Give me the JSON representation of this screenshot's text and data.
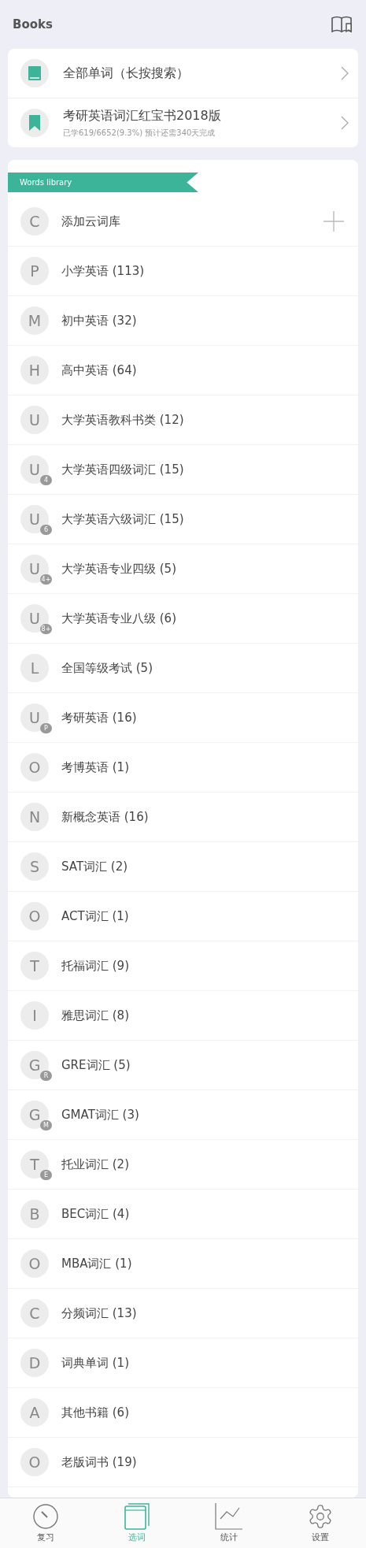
{
  "header": {
    "title": "Books"
  },
  "books": [
    {
      "kind": "all",
      "title": "全部单词（长按搜索）"
    },
    {
      "kind": "current",
      "title": "考研英语词汇红宝书2018版",
      "subtitle": "已学619/6652(9.3%) 预计还需340天完成"
    }
  ],
  "library": {
    "banner": "Words library",
    "rows": [
      {
        "kind": "add",
        "letter": "C",
        "label": "添加云词库"
      },
      {
        "kind": "book",
        "letter": "P",
        "label": "小学英语 (113)"
      },
      {
        "kind": "book",
        "letter": "M",
        "label": "初中英语 (32)"
      },
      {
        "kind": "book",
        "letter": "H",
        "label": "高中英语 (64)"
      },
      {
        "kind": "book",
        "letter": "U",
        "label": "大学英语教科书类 (12)"
      },
      {
        "kind": "book",
        "letter": "U",
        "badge": "4",
        "label": "大学英语四级词汇 (15)"
      },
      {
        "kind": "book",
        "letter": "U",
        "badge": "6",
        "label": "大学英语六级词汇 (15)"
      },
      {
        "kind": "book",
        "letter": "U",
        "badge": "4+",
        "label": "大学英语专业四级 (5)"
      },
      {
        "kind": "book",
        "letter": "U",
        "badge": "8+",
        "label": "大学英语专业八级 (6)"
      },
      {
        "kind": "book",
        "letter": "L",
        "label": "全国等级考试 (5)"
      },
      {
        "kind": "book",
        "letter": "U",
        "badge": "P",
        "label": "考研英语 (16)"
      },
      {
        "kind": "book",
        "letter": "O",
        "label": "考博英语 (1)"
      },
      {
        "kind": "book",
        "letter": "N",
        "label": "新概念英语 (16)"
      },
      {
        "kind": "book",
        "letter": "S",
        "label": "SAT词汇 (2)"
      },
      {
        "kind": "book",
        "letter": "O",
        "label": "ACT词汇 (1)"
      },
      {
        "kind": "book",
        "letter": "T",
        "label": "托福词汇 (9)"
      },
      {
        "kind": "book",
        "letter": "I",
        "label": "雅思词汇 (8)"
      },
      {
        "kind": "book",
        "letter": "G",
        "badge": "R",
        "label": "GRE词汇 (5)"
      },
      {
        "kind": "book",
        "letter": "G",
        "badge": "M",
        "label": "GMAT词汇 (3)"
      },
      {
        "kind": "book",
        "letter": "T",
        "badge": "E",
        "label": "托业词汇 (2)"
      },
      {
        "kind": "book",
        "letter": "B",
        "label": "BEC词汇 (4)"
      },
      {
        "kind": "book",
        "letter": "O",
        "label": "MBA词汇 (1)"
      },
      {
        "kind": "book",
        "letter": "C",
        "label": "分频词汇 (13)"
      },
      {
        "kind": "book",
        "letter": "D",
        "label": "词典单词 (1)"
      },
      {
        "kind": "book",
        "letter": "A",
        "label": "其他书籍 (6)"
      },
      {
        "kind": "book",
        "letter": "O",
        "label": "老版词书 (19)"
      }
    ]
  },
  "tabs": [
    {
      "kind": "review",
      "label": "复习",
      "selected": false
    },
    {
      "kind": "words",
      "label": "选词",
      "selected": true
    },
    {
      "kind": "stats",
      "label": "统计",
      "selected": false
    },
    {
      "kind": "settings",
      "label": "设置",
      "selected": false
    }
  ]
}
